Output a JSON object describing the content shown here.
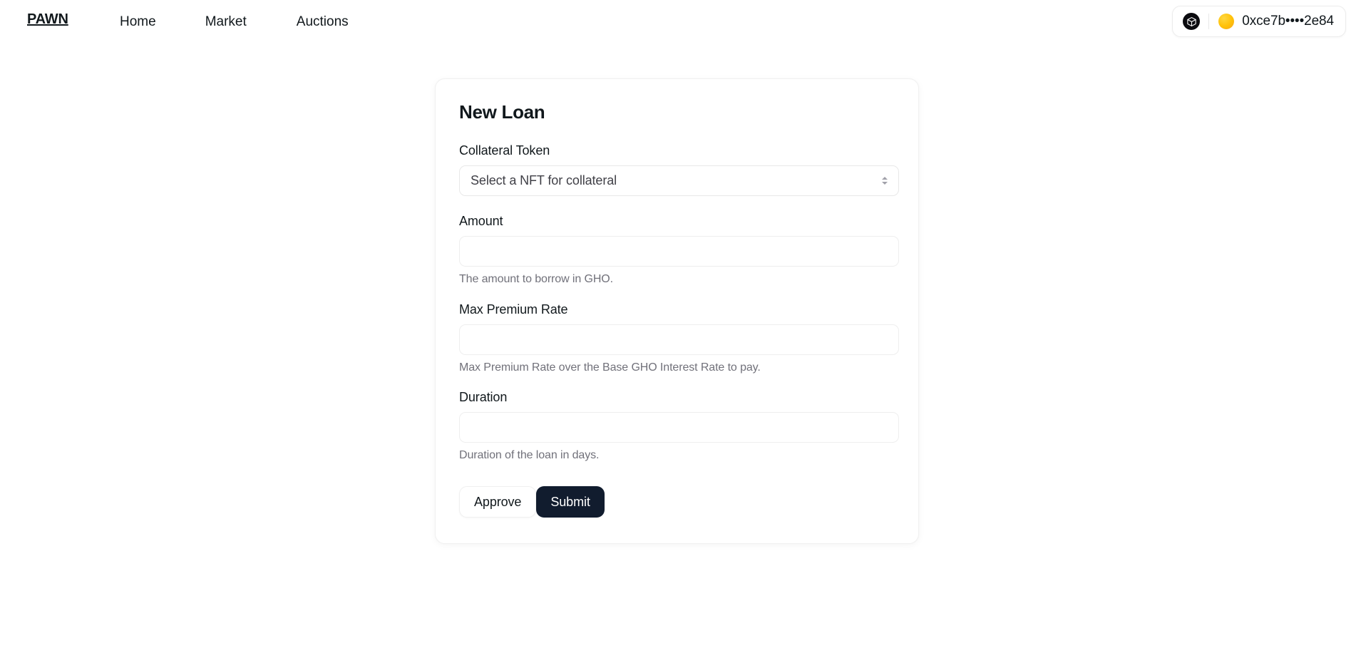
{
  "navbar": {
    "brand": "PAWN",
    "links": [
      {
        "label": "Home"
      },
      {
        "label": "Market"
      },
      {
        "label": "Auctions"
      }
    ],
    "wallet": {
      "chain_icon": "cube-icon",
      "avatar_icon": "wallet-avatar-icon",
      "address": "0xce7b••••2e84"
    }
  },
  "card": {
    "title": "New Loan",
    "fields": [
      {
        "label": "Collateral Token",
        "type": "select",
        "selected": "Select a NFT for collateral",
        "help": ""
      },
      {
        "label": "Amount",
        "type": "text",
        "value": "",
        "placeholder": "",
        "help": "The amount to borrow in GHO."
      },
      {
        "label": "Max Premium Rate",
        "type": "text",
        "value": "",
        "placeholder": "",
        "help": "Max Premium Rate over the Base GHO Interest Rate to pay."
      },
      {
        "label": "Duration",
        "type": "text",
        "value": "",
        "placeholder": "",
        "help": "Duration of the loan in days."
      }
    ],
    "buttons": {
      "approve": "Approve",
      "submit": "Submit"
    }
  },
  "colors": {
    "text": "#11181C",
    "muted": "#71717a",
    "border": "#ececec",
    "submit_bg": "#111c2e",
    "avatar_yellow": "#FFC107"
  }
}
